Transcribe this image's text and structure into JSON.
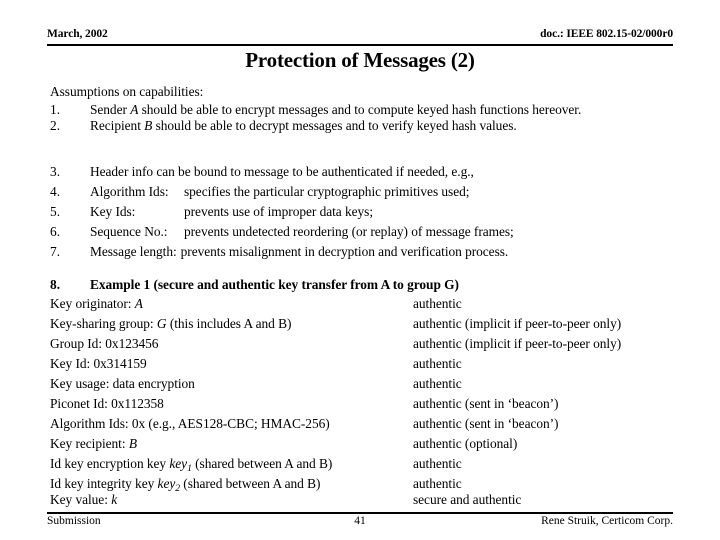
{
  "header": {
    "date": "March, 2002",
    "doc_id": "doc.: IEEE 802.15-02/000r0"
  },
  "title": "Protection of Messages (2)",
  "intro": "Assumptions on capabilities:",
  "assumptions": [
    {
      "number": "1.",
      "prefix": "Sender ",
      "var": "A",
      "suffix": " should be able to encrypt messages and to compute keyed hash functions hereover."
    },
    {
      "number": "2.",
      "prefix": "Recipient ",
      "var": "B",
      "suffix": " should be able to decrypt messages and to verify keyed hash values."
    }
  ],
  "header_items": [
    {
      "number": "3.",
      "label": "",
      "text": "Header info can be bound to message to be authenticated if needed, e.g.,"
    },
    {
      "number": "4.",
      "label": "Algorithm Ids:",
      "text": "specifies the particular cryptographic primitives used;"
    },
    {
      "number": "5.",
      "label": "Key Ids:",
      "text": "prevents use of improper data keys;"
    },
    {
      "number": "6.",
      "label": "Sequence No.:",
      "text": "prevents undetected reordering (or replay) of message frames;"
    },
    {
      "number": "7.",
      "label": "Message length:",
      "text": "prevents misalignment in decryption and verification process."
    }
  ],
  "example": {
    "number": "8.",
    "title": "Example 1 (secure and authentic key transfer from A to group G)",
    "rows": [
      {
        "left_pre": "Key originator: ",
        "left_var": "A",
        "left_post": "",
        "right": "authentic"
      },
      {
        "left_pre": "Key-sharing group: ",
        "left_var": "G",
        "left_post": " (this includes A and B)",
        "right": "authentic (implicit if peer-to-peer only)"
      },
      {
        "left_pre": "Group Id: 0x123456",
        "left_var": "",
        "left_post": "",
        "right": "authentic (implicit if peer-to-peer only)"
      },
      {
        "left_pre": "Key Id: 0x314159",
        "left_var": "",
        "left_post": "",
        "right": "authentic"
      },
      {
        "left_pre": "Key usage: data encryption",
        "left_var": "",
        "left_post": "",
        "right": "authentic"
      },
      {
        "left_pre": "Piconet Id: 0x112358",
        "left_var": "",
        "left_post": "",
        "right": "authentic (sent in ‘beacon’)"
      },
      {
        "left_pre": "Algorithm Ids: 0x (e.g., AES128-CBC; HMAC-256)",
        "left_var": "",
        "left_post": "",
        "right": "authentic (sent in ‘beacon’)"
      },
      {
        "left_pre": "Key recipient: ",
        "left_var": "B",
        "left_post": "",
        "right": "authentic (optional)"
      },
      {
        "left_pre": "Id key encryption key ",
        "left_var": "key",
        "left_sub": "1",
        "left_post": " (shared between A and B)",
        "right": "authentic"
      },
      {
        "left_pre": "Id key integrity key ",
        "left_var": "key",
        "left_sub": "2",
        "left_post": " (shared between A and B)",
        "right": "authentic"
      },
      {
        "left_pre": "Key value: ",
        "left_var": "k",
        "left_post": "",
        "right": "secure and authentic"
      }
    ]
  },
  "footer": {
    "left": "Submission",
    "page": "41",
    "right": "Rene Struik, Certicom Corp."
  }
}
